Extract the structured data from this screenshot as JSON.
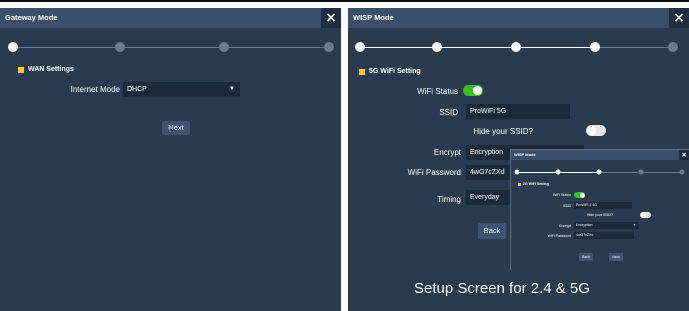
{
  "colors": {
    "panel_bg": "#2a3b4f",
    "title_bar": "#3a4f6a",
    "accent_yellow": "#f5d21a",
    "toggle_on": "#36c21a",
    "field_bg": "#1c2a3a"
  },
  "left": {
    "title": "Gateway Mode",
    "close": "×",
    "steps": 4,
    "current_step": 1,
    "section": "WAN Settings",
    "internet_mode_label": "Internet Mode",
    "internet_mode_value": "DHCP",
    "next_button": "Next"
  },
  "right": {
    "title": "WISP Mode",
    "close": "×",
    "steps": 5,
    "current_step": 4,
    "section": "5G WiFi Setting",
    "wifi_status_label": "WiFi Status",
    "wifi_status_on": true,
    "ssid_label": "SSID",
    "ssid_value": "ProWiFi 5G",
    "hide_ssid_label": "Hide your SSID?",
    "hide_ssid_on": false,
    "encrypt_label": "Encrypt",
    "encrypt_value": "Encryption",
    "password_label": "WiFi Password",
    "password_value": "4wG7cZXd",
    "timing_label": "Timing",
    "timing_value": "Everyday",
    "back_button": "Back"
  },
  "inset": {
    "title": "WISP Mode",
    "close": "×",
    "steps": 5,
    "current_step": 3,
    "section": "2G WiFi Setting",
    "wifi_status_label": "WiFi Status",
    "wifi_status_on": true,
    "ssid_label": "SSID",
    "ssid_value": "ProWiFi 2.4G",
    "hide_ssid_label": "Hide your SSID?",
    "hide_ssid_on": false,
    "encrypt_label": "Encrypt",
    "encrypt_value": "Encryption",
    "password_label": "WiFi Password",
    "password_value": "4wG7cZXd",
    "back_button": "Back",
    "next_button": "Next"
  },
  "caption": "Setup Screen for 2.4 & 5G"
}
